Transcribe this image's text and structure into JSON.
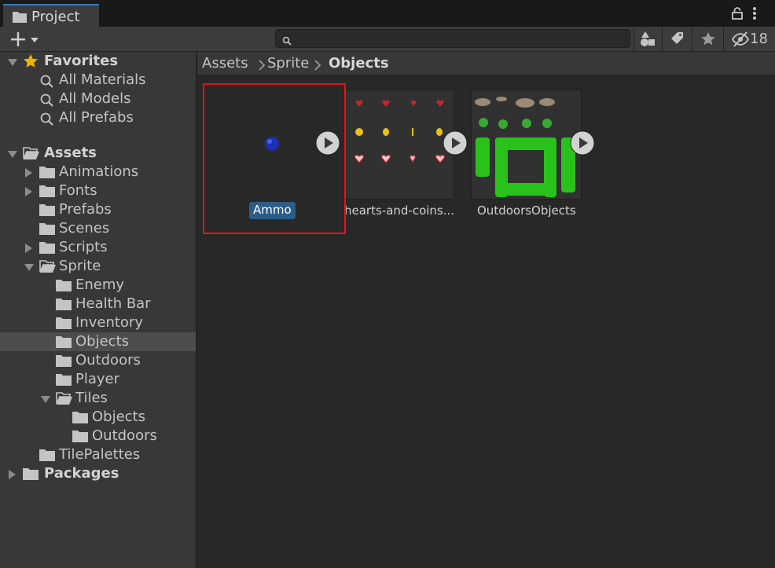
{
  "window": {
    "tab_title": "Project",
    "tab_icon": "folder-icon",
    "lock_icon": "lock-icon",
    "menu_icon": "kebab-menu-icon"
  },
  "toolbar": {
    "create_icon": "plus-icon",
    "search_placeholder": "",
    "search_value": "",
    "hidden_packages_count": "18",
    "buttons": [
      "search-by-type-icon",
      "search-by-label-icon",
      "favorites-star-icon",
      "hidden-packages-icon"
    ]
  },
  "tree": {
    "favorites": {
      "label": "Favorites",
      "items": [
        "All Materials",
        "All Models",
        "All Prefabs"
      ]
    },
    "assets": {
      "label": "Assets",
      "items": [
        {
          "label": "Animations"
        },
        {
          "label": "Fonts"
        },
        {
          "label": "Prefabs"
        },
        {
          "label": "Scenes"
        },
        {
          "label": "Scripts"
        },
        {
          "label": "Sprite"
        },
        {
          "label": "Enemy"
        },
        {
          "label": "Health Bar"
        },
        {
          "label": "Inventory"
        },
        {
          "label": "Objects"
        },
        {
          "label": "Outdoors"
        },
        {
          "label": "Player"
        },
        {
          "label": "Tiles"
        },
        {
          "label": "Objects"
        },
        {
          "label": "Outdoors"
        },
        {
          "label": "TilePalettes"
        }
      ]
    },
    "packages": {
      "label": "Packages"
    }
  },
  "breadcrumb": [
    "Assets",
    "Sprite",
    "Objects"
  ],
  "assets": [
    {
      "name": "Ammo"
    },
    {
      "name": "hearts-and-coins..."
    },
    {
      "name": "OutdoorsObjects"
    }
  ],
  "colors": {
    "selection_outline": "#e0151a",
    "selected_label_bg": "#2c5d87",
    "tab_accent": "#3a79bb",
    "star": "#f0b400"
  }
}
